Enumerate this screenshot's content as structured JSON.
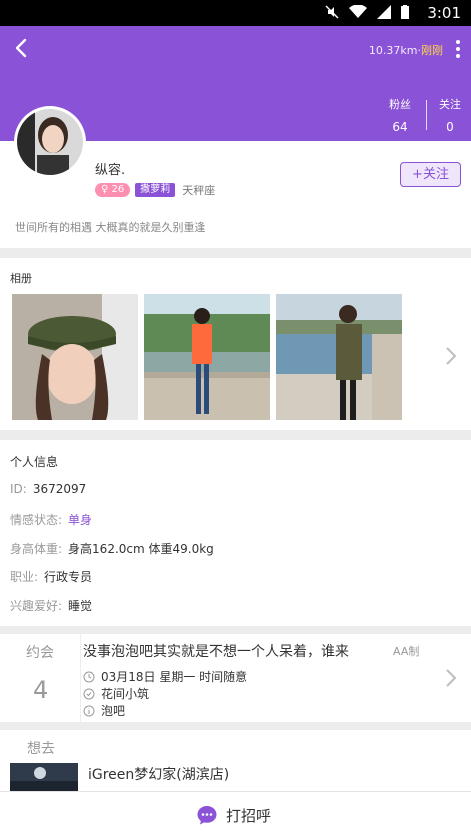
{
  "status_bar": {
    "time": "3:01"
  },
  "header": {
    "distance": "10.37km",
    "separator": "·",
    "last_active": "刚刚",
    "stats": [
      {
        "label": "粉丝",
        "value": "64"
      },
      {
        "label": "关注",
        "value": "0"
      }
    ]
  },
  "profile": {
    "name": "纵容.",
    "gender_age": "♀ 26",
    "title_tag": "撒萝莉",
    "zodiac": "天秤座",
    "follow_label": "+关注",
    "signature": "世间所有的相遇 大概真的就是久别重逢"
  },
  "album": {
    "title": "相册",
    "photos": [
      "photo-1",
      "photo-2",
      "photo-3"
    ]
  },
  "info": {
    "title": "个人信息",
    "rows": [
      {
        "key": "ID:",
        "value": "3672097"
      },
      {
        "key": "情感状态:",
        "value": "单身"
      },
      {
        "key": "身高体重:",
        "value": "身高162.0cm 体重49.0kg"
      },
      {
        "key": "职业:",
        "value": "行政专员"
      },
      {
        "key": "兴趣爱好:",
        "value": "睡觉"
      }
    ]
  },
  "date_section": {
    "label": "约会",
    "count": "4",
    "headline": "没事泡泡吧其实就是不想一个人呆着，谁来",
    "payment": "AA制",
    "when": "03月18日 星期一 时间随意",
    "place": "花间小筑",
    "activity": "泡吧"
  },
  "want_section": {
    "label": "想去",
    "place": "iGreen梦幻家(湖滨店)"
  },
  "bottom": {
    "greet_label": "打招呼"
  },
  "colors": {
    "accent": "#8a52d6",
    "highlight": "#ffd64a"
  }
}
